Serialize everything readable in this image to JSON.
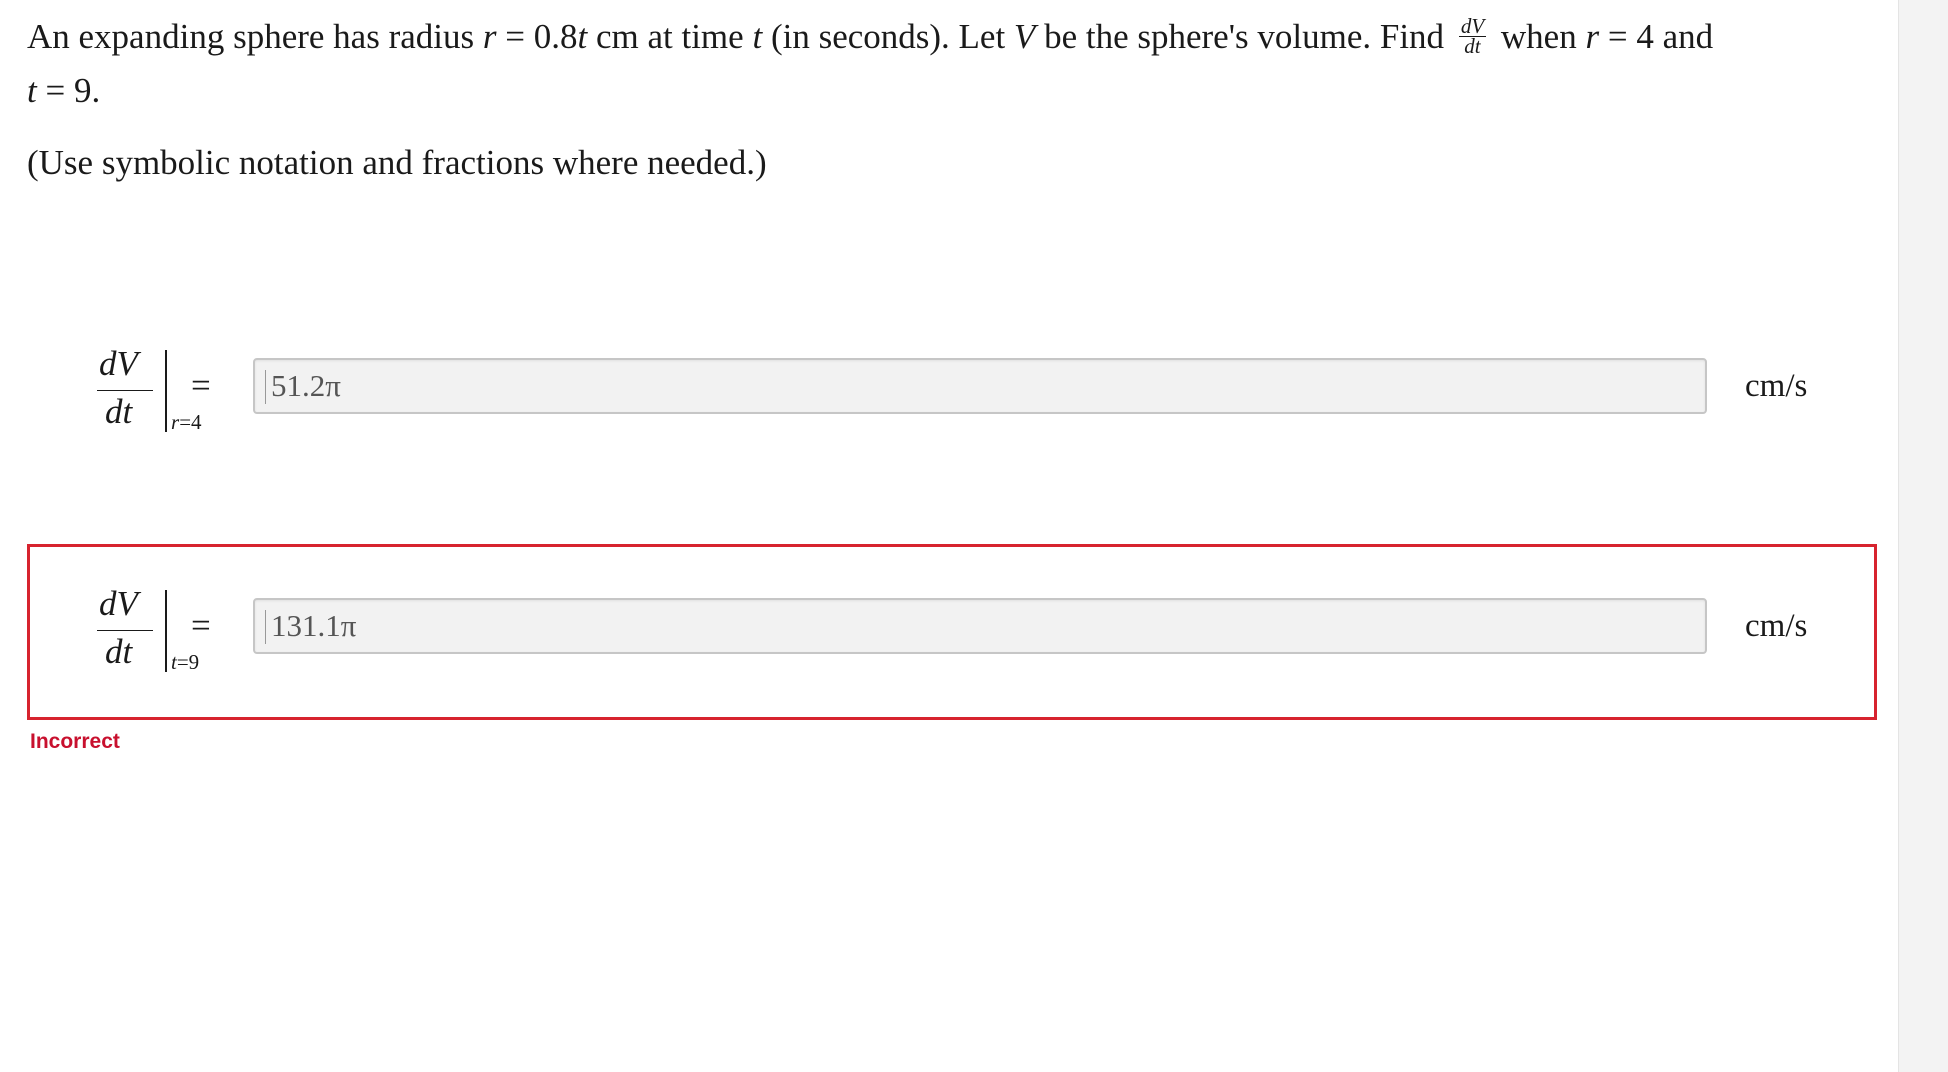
{
  "problem": {
    "part1": "An expanding sphere has radius ",
    "var_r": "r",
    "part2": " = 0.8",
    "var_t1": "t",
    "part3": " cm at time ",
    "var_t2": "t",
    "part4": " (in seconds). Let ",
    "var_V": "V",
    "part5": " be the sphere's volume. Find ",
    "frac_num": "dV",
    "frac_den": "dt",
    "part6": " when ",
    "var_r2": "r",
    "part7": " = 4 and",
    "var_t3": "t",
    "part8": " = 9."
  },
  "instruction": "(Use symbolic notation and fractions where needed.)",
  "answers": [
    {
      "deriv_num": "dV",
      "deriv_den": "dt",
      "eval_var": "r",
      "eval_value": "=4",
      "equals": "=",
      "value": "51.2π",
      "unit": "cm/s",
      "status": ""
    },
    {
      "deriv_num": "dV",
      "deriv_den": "dt",
      "eval_var": "t",
      "eval_value": "=9",
      "equals": "=",
      "value": "131.1π",
      "unit": "cm/s",
      "status": "incorrect"
    }
  ],
  "feedback": "Incorrect",
  "colors": {
    "error": "#d7232f",
    "input_bg": "#f2f2f2"
  }
}
